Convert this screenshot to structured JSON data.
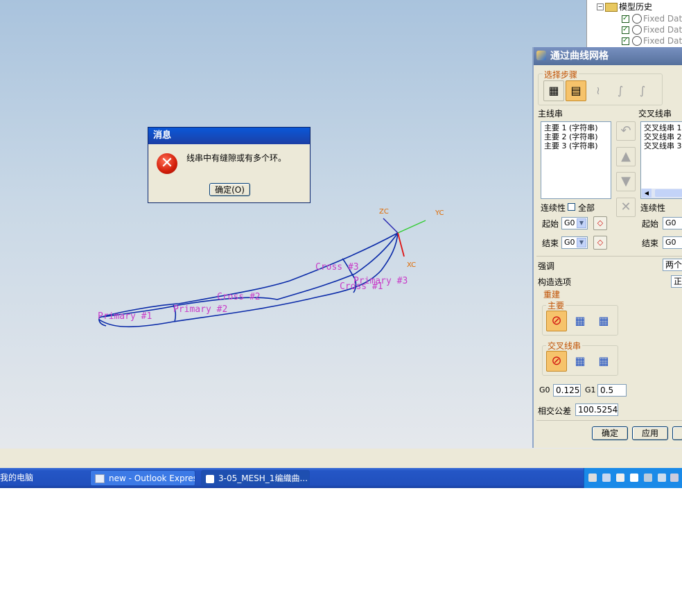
{
  "tree": {
    "root_label": "模型历史",
    "items": [
      "Fixed Datum",
      "Fixed Datum",
      "Fixed Datum"
    ]
  },
  "viewport": {
    "axes": {
      "zc": "ZC",
      "yc": "YC",
      "xc": "XC"
    },
    "curve_labels": {
      "primary1": "Primary #1",
      "primary2": "Primary #2",
      "primary3": "Primary #3",
      "cross1": "Cross #1",
      "cross2": "Cross #2",
      "cross3": "Cross #3"
    }
  },
  "message": {
    "title": "消息",
    "text": "线串中有缝隙或有多个环。",
    "ok_label": "确定(O)",
    "icon": "error-icon"
  },
  "panel": {
    "title": "通过曲线网格",
    "steps_label": "选择步骤",
    "primary_label": "主线串",
    "cross_label": "交叉线串",
    "primary_items": [
      "主要 1 (字符串)",
      "主要 2 (字符串)",
      "主要 3 (字符串)"
    ],
    "cross_items": [
      "交叉线串 1",
      "交叉线串 2",
      "交叉线串 3"
    ],
    "continuity_label": "连续性",
    "all_label": "全部",
    "start_label": "起始",
    "end_label": "结束",
    "g0_value": "G0",
    "emphasis_label": "强调",
    "emphasis_value": "两个",
    "construction_label": "构造选项",
    "construction_value": "正",
    "rebuild_label": "重建",
    "rebuild_primary_label": "主要",
    "rebuild_cross_label": "交叉线串",
    "g0_label": "G0",
    "g0_tol": "0.125",
    "g1_label": "G1",
    "g1_tol": "0.5",
    "intersect_tol_label": "相交公差",
    "intersect_tol": "100.5254",
    "ok_label": "确定",
    "apply_label": "应用"
  },
  "taskbar": {
    "my_computer": "我的电脑",
    "task1": "new - Outlook Express...",
    "task2": "3-05_MESH_1编織曲..."
  },
  "colors": {
    "curve": "#0a2aa8",
    "label": "#c83cc8",
    "axis_label": "#e06a00",
    "title_xp": "#0a58d8",
    "taskbar": "#2456c6"
  }
}
